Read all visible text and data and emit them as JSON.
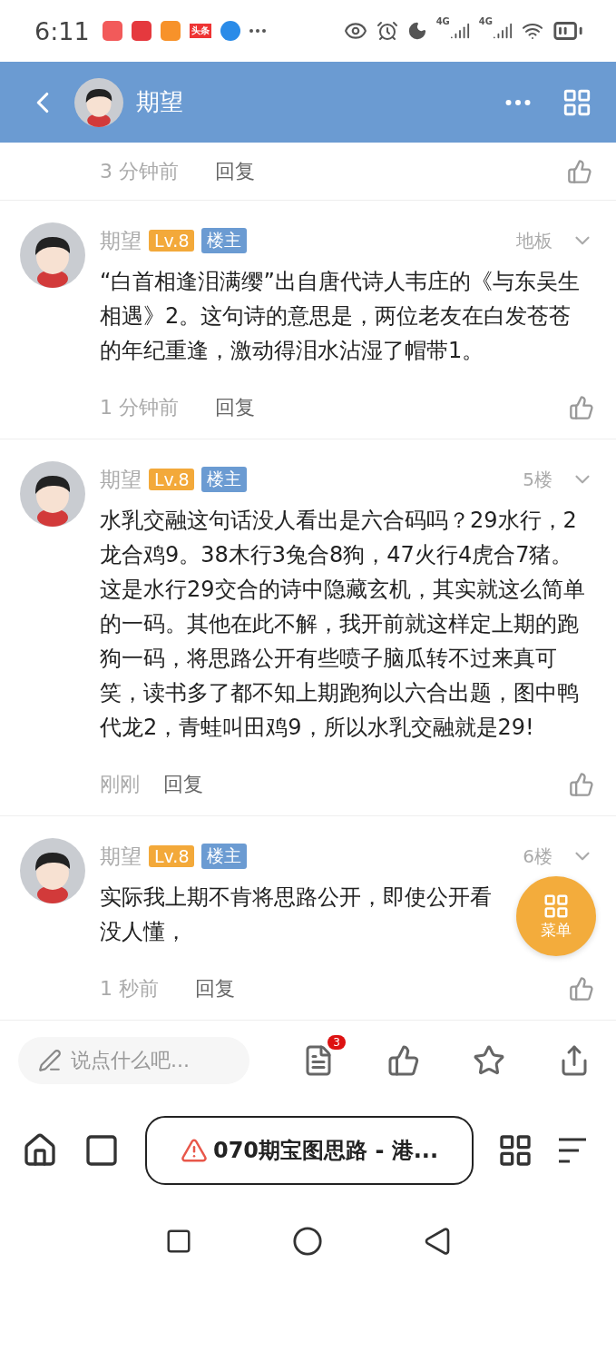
{
  "status_bar": {
    "time": "6:11",
    "news_badge": "头条",
    "network_labels": [
      "4G",
      "4G"
    ]
  },
  "header": {
    "title": "期望"
  },
  "partial_comment": {
    "time": "3 分钟前",
    "reply": "回复"
  },
  "comments": [
    {
      "author": "期望",
      "level": "Lv.8",
      "role": "楼主",
      "floor": "地板",
      "text": "“白首相逢泪满缨”出自唐代诗人韦庄的《与东吴生相遇》2。这句诗的意思是，两位老友在白发苍苍的年纪重逢，激动得泪水沾湿了帽带1。",
      "time": "1 分钟前",
      "reply": "回复"
    },
    {
      "author": "期望",
      "level": "Lv.8",
      "role": "楼主",
      "floor": "5楼",
      "text": "水乳交融这句话没人看出是六合码吗？29水行，2龙合鸡9。38木行3兔合8狗，47火行4虎合7猪。这是水行29交合的诗中隐藏玄机，其实就这么简单的一码。其他在此不解，我开前就这样定上期的跑狗一码，将思路公开有些喷子脑瓜转不过来真可笑，读书多了都不知上期跑狗以六合出题，图中鸭代龙2，青蛙叫田鸡9，所以水乳交融就是29!",
      "time": "刚刚",
      "reply": "回复"
    },
    {
      "author": "期望",
      "level": "Lv.8",
      "role": "楼主",
      "floor": "6楼",
      "text": "实际我上期不肯将思路公开，即使公开看没人懂，",
      "time": "1 秒前",
      "reply": "回复"
    }
  ],
  "fab": {
    "label": "菜单"
  },
  "action_bar": {
    "placeholder": "说点什么吧...",
    "comment_count": "3"
  },
  "nav_bar": {
    "tab_title": "070期宝图思路 - 港..."
  }
}
